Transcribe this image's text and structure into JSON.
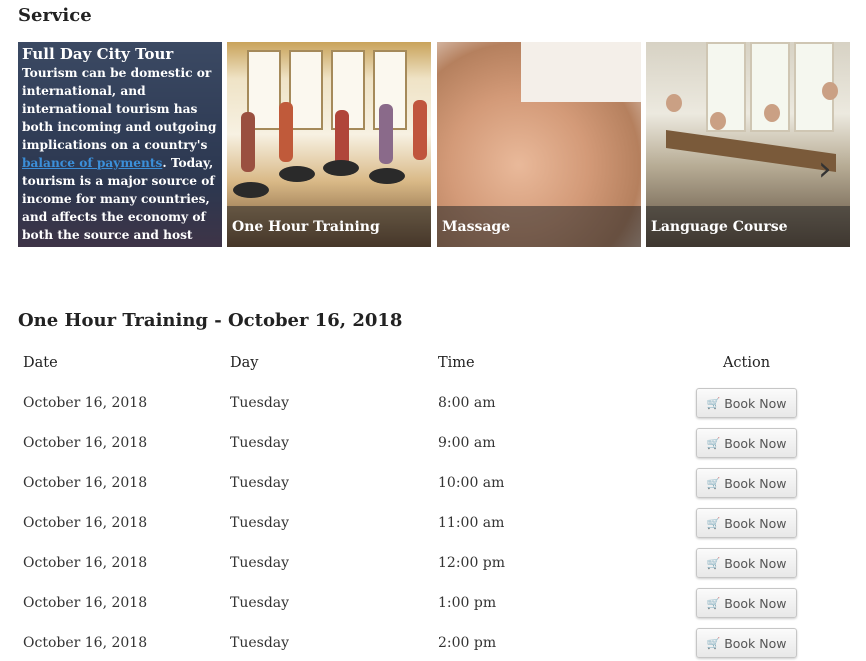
{
  "section_title": "Service",
  "services": [
    {
      "title": "Full Day City Tour",
      "text_before": "Tourism can be domestic or international, and international tourism has both incoming and outgoing implications on a country's ",
      "link_text": "balance of payments",
      "text_after": ". Today, tourism is a major source of income for many countries, and affects the economy of both the source and host countries, in some cases being of vital"
    },
    {
      "title": "One Hour Training"
    },
    {
      "title": "Massage"
    },
    {
      "title": "Language Course"
    }
  ],
  "schedule_title": "One Hour Training - October 16, 2018",
  "table": {
    "headers": {
      "date": "Date",
      "day": "Day",
      "time": "Time",
      "action": "Action"
    },
    "rows": [
      {
        "date": "October 16, 2018",
        "day": "Tuesday",
        "time": "8:00 am",
        "action": "Book Now"
      },
      {
        "date": "October 16, 2018",
        "day": "Tuesday",
        "time": "9:00 am",
        "action": "Book Now"
      },
      {
        "date": "October 16, 2018",
        "day": "Tuesday",
        "time": "10:00 am",
        "action": "Book Now"
      },
      {
        "date": "October 16, 2018",
        "day": "Tuesday",
        "time": "11:00 am",
        "action": "Book Now"
      },
      {
        "date": "October 16, 2018",
        "day": "Tuesday",
        "time": "12:00 pm",
        "action": "Book Now"
      },
      {
        "date": "October 16, 2018",
        "day": "Tuesday",
        "time": "1:00 pm",
        "action": "Book Now"
      },
      {
        "date": "October 16, 2018",
        "day": "Tuesday",
        "time": "2:00 pm",
        "action": "Book Now"
      }
    ]
  },
  "icons": {
    "book_button": "cart-icon",
    "carousel_next": "chevron-right-icon"
  }
}
